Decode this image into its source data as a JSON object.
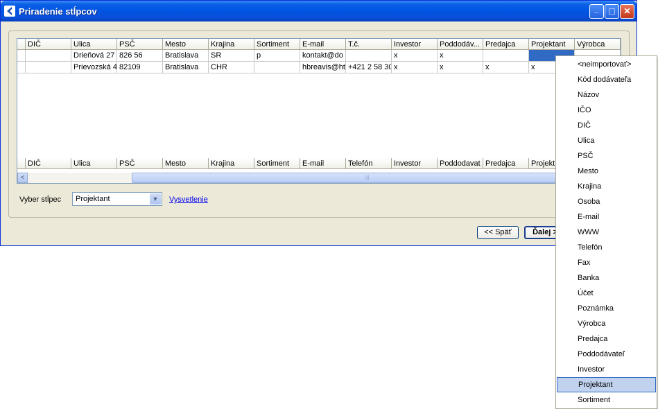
{
  "window": {
    "title": "Priradenie stĺpcov"
  },
  "titlebar_buttons": {
    "minimize": "_",
    "maximize": "□",
    "close": "✕"
  },
  "grid": {
    "headers": [
      "DIČ",
      "Ulica",
      "PSČ",
      "Mesto",
      "Krajina",
      "Sortiment",
      "E-mail",
      "T.č.",
      "Investor",
      "Poddodáv...",
      "Predajca",
      "Projektant",
      "Výrobca"
    ],
    "rows": [
      [
        "",
        "Drieňová 27",
        "826 56",
        "Bratislava",
        "SR",
        "p",
        "kontakt@do",
        "",
        "x",
        "x",
        "",
        "",
        ""
      ],
      [
        "",
        "Prievozská 4",
        "82109",
        "Bratislava",
        "CHR",
        "",
        "hbreavis@ht",
        "+421 2 58 30",
        "x",
        "x",
        "x",
        "x",
        ""
      ]
    ],
    "selected_cell": {
      "row": 0,
      "col": 11
    },
    "mapping_headers": [
      "DIČ",
      "Ulica",
      "PSČ",
      "Mesto",
      "Krajina",
      "Sortiment",
      "E-mail",
      "Telefón",
      "Investor",
      "Poddodavat",
      "Predajca",
      "Projekt"
    ],
    "scroll_left_arrow": "<",
    "scroll_thumb_grip": "|||"
  },
  "column_select": {
    "label": "Vyber stĺpec",
    "value": "Projektant",
    "arrow": "▼"
  },
  "help_link": "Vysvetlenie",
  "buttons": {
    "back": "<< Späť",
    "next": "Ďalej >"
  },
  "dropdown": {
    "items": [
      "<neimportovať>",
      "Kód dodávateľa",
      "Názov",
      "IČO",
      "DIČ",
      "Ulica",
      "PSČ",
      "Mesto",
      "Krajina",
      "Osoba",
      "E-mail",
      "WWW",
      "Telefón",
      "Fax",
      "Banka",
      "Účet",
      "Poznámka",
      "Výrobca",
      "Predajca",
      "Poddodávateľ",
      "Investor",
      "Projektant",
      "Sortiment"
    ],
    "highlighted_index": 21
  }
}
